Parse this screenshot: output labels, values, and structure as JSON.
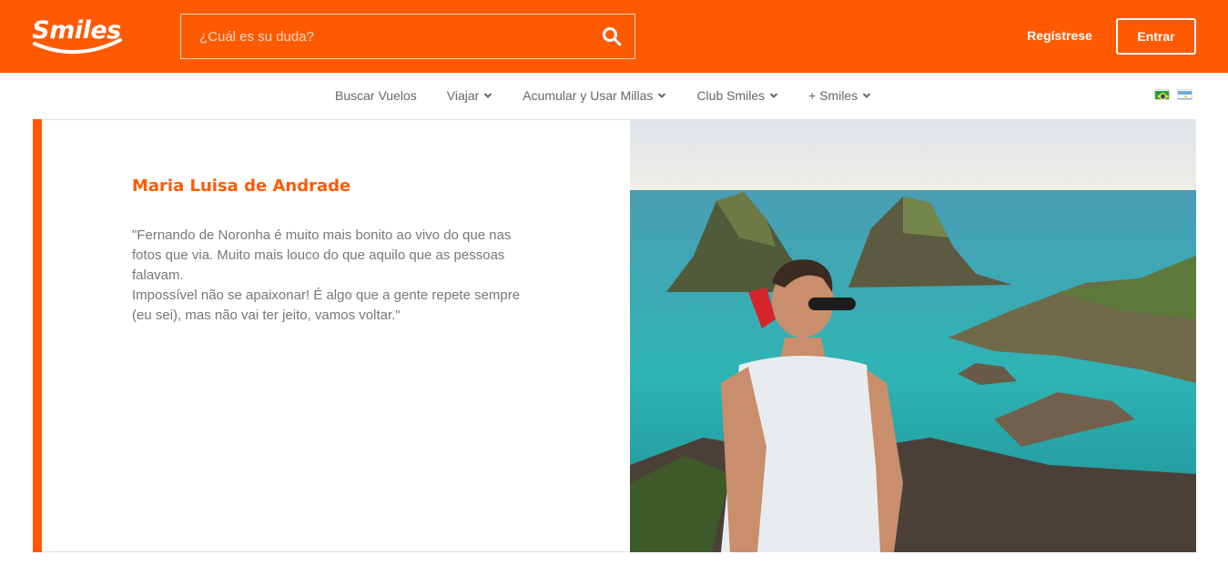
{
  "header": {
    "logo_text": "Smiles",
    "search_placeholder": "¿Cuál es su duda?",
    "register_label": "Regístrese",
    "login_label": "Entrar"
  },
  "nav": {
    "items": [
      {
        "label": "Buscar Vuelos",
        "has_dropdown": false
      },
      {
        "label": "Viajar",
        "has_dropdown": true
      },
      {
        "label": "Acumular y Usar Millas",
        "has_dropdown": true
      },
      {
        "label": "Club Smiles",
        "has_dropdown": true
      },
      {
        "label": "+ Smiles",
        "has_dropdown": true
      }
    ],
    "flags": [
      "brazil-flag-icon",
      "argentina-flag-icon"
    ]
  },
  "testimonial": {
    "author": "Maria Luisa de Andrade",
    "quote": "\"Fernando de Noronha é muito mais bonito ao vivo do que nas fotos que via. Muito mais louco do que aquilo que as pessoas falavam.\nImpossível não se apaixonar! É algo que a gente repete sempre (eu sei), mas não vai ter jeito, vamos voltar.\""
  },
  "colors": {
    "brand": "#ff5a00",
    "text_gray": "#777777"
  }
}
